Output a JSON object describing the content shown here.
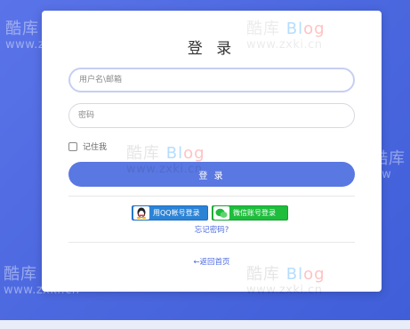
{
  "watermark": {
    "brand_cn": "酷库",
    "brand_en_1": "Bl",
    "brand_en_2": "og",
    "url": "www.zxki.cn"
  },
  "login": {
    "title": "登 录",
    "username_placeholder": "用户名\\邮箱",
    "password_placeholder": "密码",
    "remember_label": "记住我",
    "submit_label": "登 录",
    "qq_label": "用QQ帐号登录",
    "wechat_label": "微信账号登录",
    "forgot_label": "忘记密码?",
    "back_home_label": "←返回首页"
  },
  "colors": {
    "background": "#4d69e0",
    "primary_button": "#5a78e2",
    "qq_button": "#2b83d6",
    "wechat_button": "#1ebd3c",
    "link": "#4d6be0"
  }
}
